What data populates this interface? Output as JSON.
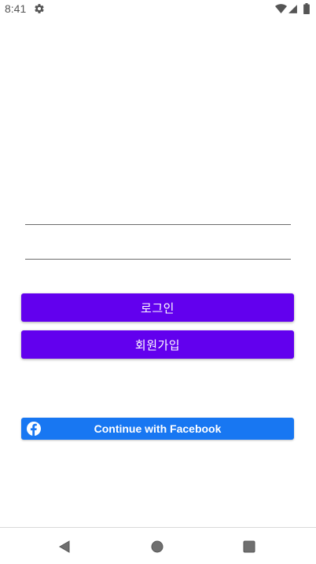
{
  "status_bar": {
    "time": "8:41",
    "icons": [
      "gear-icon",
      "wifi-icon",
      "signal-icon",
      "battery-icon"
    ]
  },
  "form": {
    "id_field": {
      "value": "",
      "placeholder": ""
    },
    "password_field": {
      "value": "",
      "placeholder": ""
    }
  },
  "buttons": {
    "login_label": "로그인",
    "signup_label": "회원가입",
    "facebook_label": "Continue with Facebook"
  },
  "nav_bar": {
    "icons": [
      "back-icon",
      "home-icon",
      "recent-apps-icon"
    ]
  },
  "colors": {
    "primary": "#6200ee",
    "facebook": "#1877f2",
    "underline": "#6b6b6b"
  }
}
